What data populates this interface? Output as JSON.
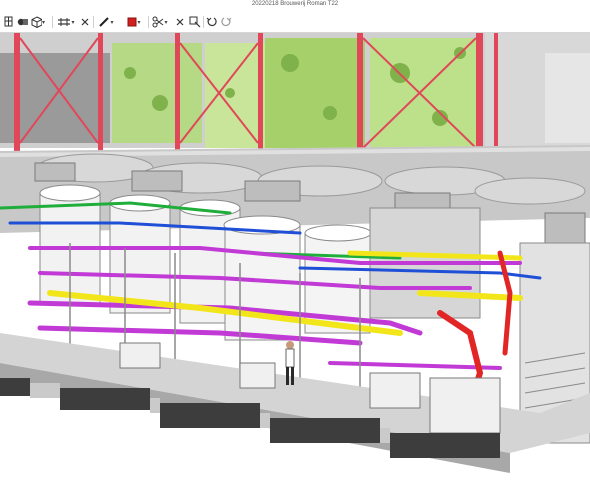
{
  "window": {
    "title": "20220218 Brouwerij Roman T22"
  },
  "toolbar": {
    "tools": [
      {
        "name": "view-cube-icon",
        "label": ""
      },
      {
        "name": "render-mode-icon",
        "label": ""
      },
      {
        "name": "section-plane-icon",
        "label": ""
      },
      {
        "name": "close-section-icon",
        "label": ""
      },
      {
        "name": "markup-pen-icon",
        "label": ""
      },
      {
        "name": "color-swatch-icon",
        "label": ""
      },
      {
        "name": "cut-icon",
        "label": ""
      },
      {
        "name": "clear-icon",
        "label": ""
      },
      {
        "name": "measure-icon",
        "label": ""
      },
      {
        "name": "undo-icon",
        "label": ""
      },
      {
        "name": "redo-icon",
        "label": ""
      }
    ],
    "markup_color": "#d0201f"
  },
  "scene": {
    "description_colors": {
      "steel_red": "#e0485a",
      "pipe_magenta": "#c23ad6",
      "pipe_yellow": "#f2e61a",
      "pipe_green": "#1fae3a",
      "pipe_blue": "#1f4fd6",
      "foliage": "#a8d860"
    }
  }
}
